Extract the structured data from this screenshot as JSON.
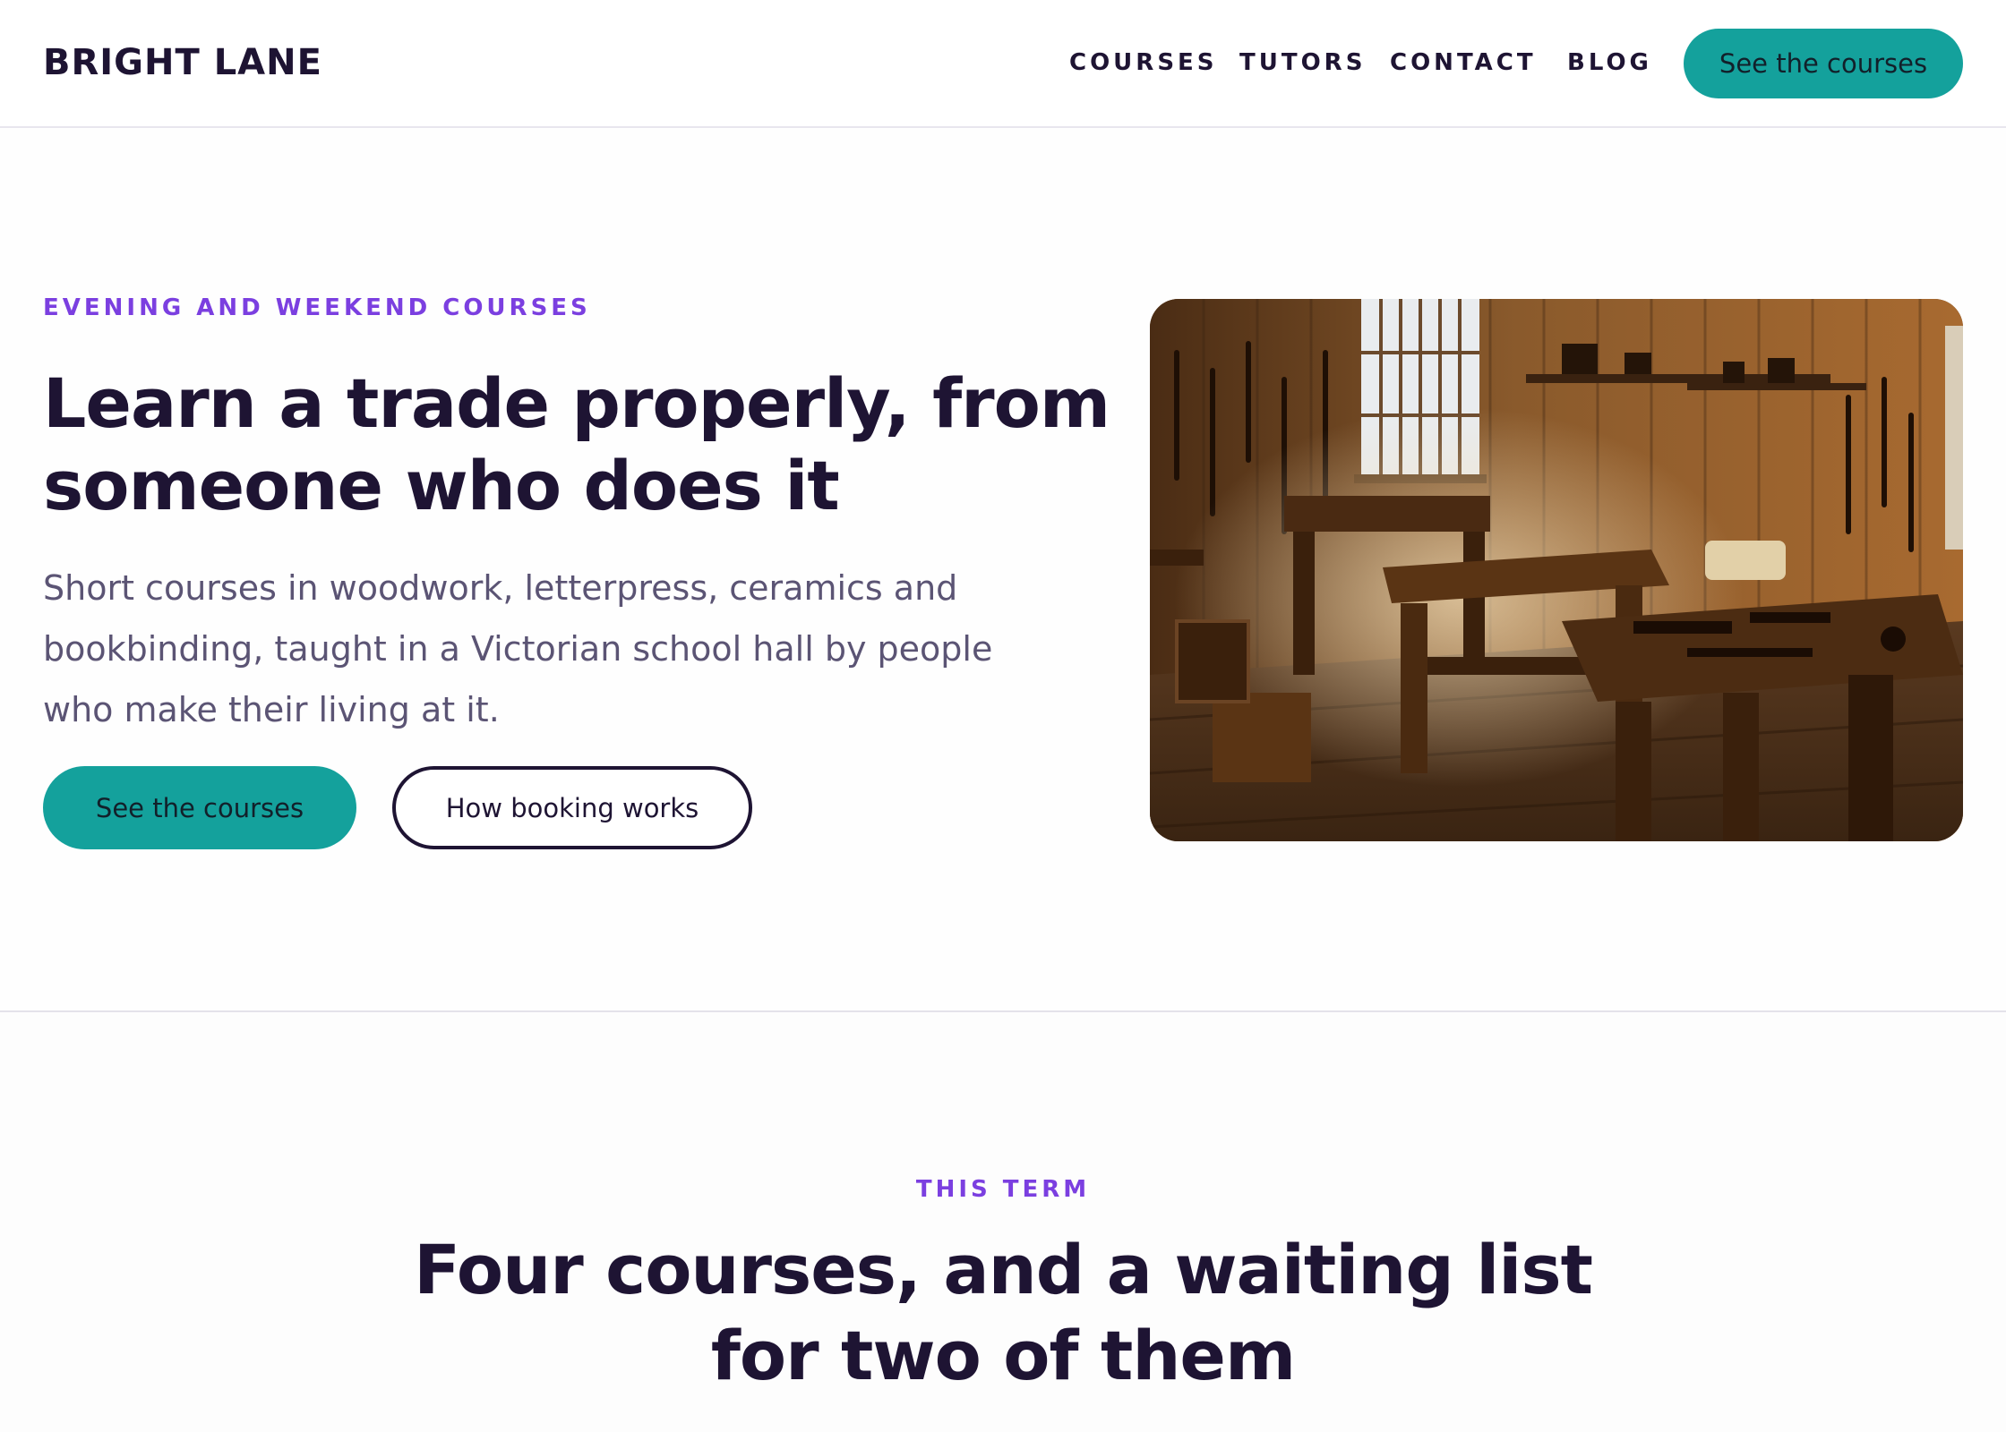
{
  "brand": {
    "name": "BRIGHT LANE"
  },
  "nav": {
    "items": [
      {
        "label": "COURSES"
      },
      {
        "label": "TUTORS"
      },
      {
        "label": "CONTACT"
      },
      {
        "label": "BLOG"
      }
    ],
    "cta_label": "See the courses"
  },
  "hero": {
    "eyebrow": "EVENING AND WEEKEND COURSES",
    "title": "Learn a trade properly, from someone who does it",
    "subtitle": "Short courses in woodwork, letterpress, ceramics and bookbinding, taught in a Victorian school hall by people who make their living at it.",
    "primary_cta": "See the courses",
    "secondary_cta": "How booking works",
    "image_icon": "workshop-photo"
  },
  "courses": {
    "eyebrow": "THIS TERM",
    "title": "Four courses, and a waiting list for two of them"
  },
  "colors": {
    "accent": "#14a19c",
    "eyebrow": "#7b3fe0",
    "heading": "#1e1433",
    "body_text": "#5b5474"
  }
}
